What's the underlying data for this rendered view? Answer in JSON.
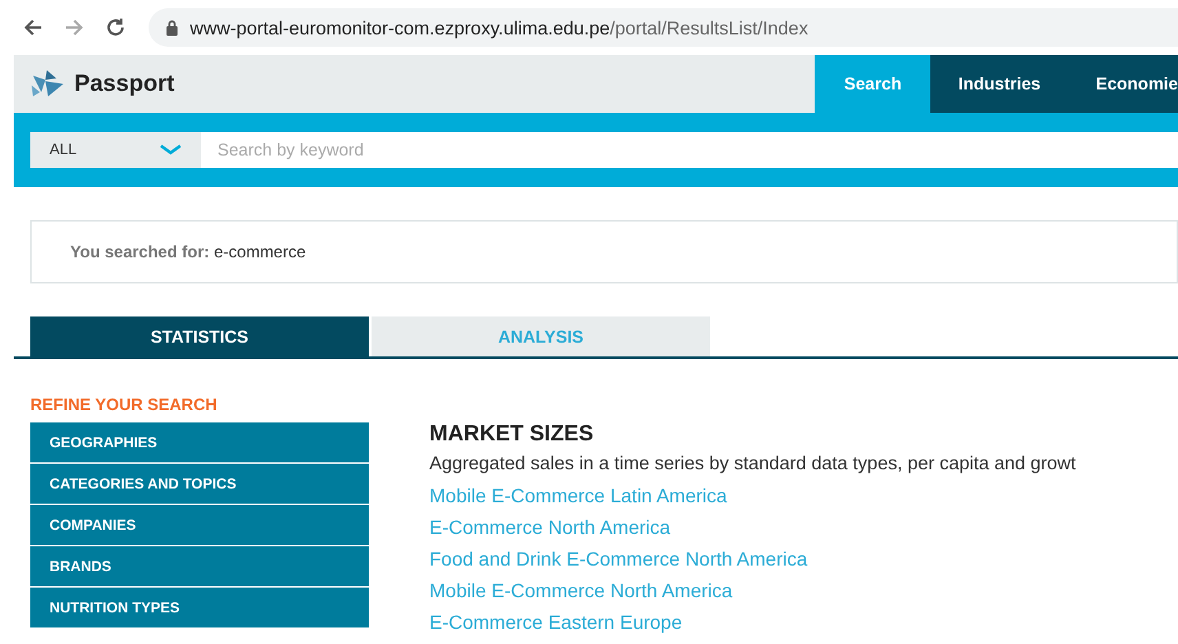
{
  "browser": {
    "url_host": "www-portal-euromonitor-com.ezproxy.ulima.edu.pe",
    "url_path": "/portal/ResultsList/Index"
  },
  "header": {
    "logo": "Passport",
    "nav": [
      {
        "label": "Search",
        "selected": true
      },
      {
        "label": "Industries",
        "selected": false
      },
      {
        "label": "Economie",
        "selected": false
      }
    ]
  },
  "search": {
    "scope": "ALL",
    "placeholder": "Search by keyword"
  },
  "query": {
    "label": "You searched for:",
    "value": "e-commerce"
  },
  "tabs": [
    {
      "label": "STATISTICS",
      "selected": true
    },
    {
      "label": "ANALYSIS",
      "selected": false
    }
  ],
  "refine": {
    "title": "REFINE YOUR SEARCH",
    "items": [
      "GEOGRAPHIES",
      "CATEGORIES AND TOPICS",
      "COMPANIES",
      "BRANDS",
      "NUTRITION TYPES"
    ]
  },
  "results": {
    "title": "MARKET SIZES",
    "description": "Aggregated sales in a time series by standard data types, per capita and growt",
    "links": [
      "Mobile E-Commerce Latin America",
      "E-Commerce North America",
      "Food and Drink E-Commerce North America",
      "Mobile E-Commerce North America",
      "E-Commerce Eastern Europe"
    ]
  }
}
